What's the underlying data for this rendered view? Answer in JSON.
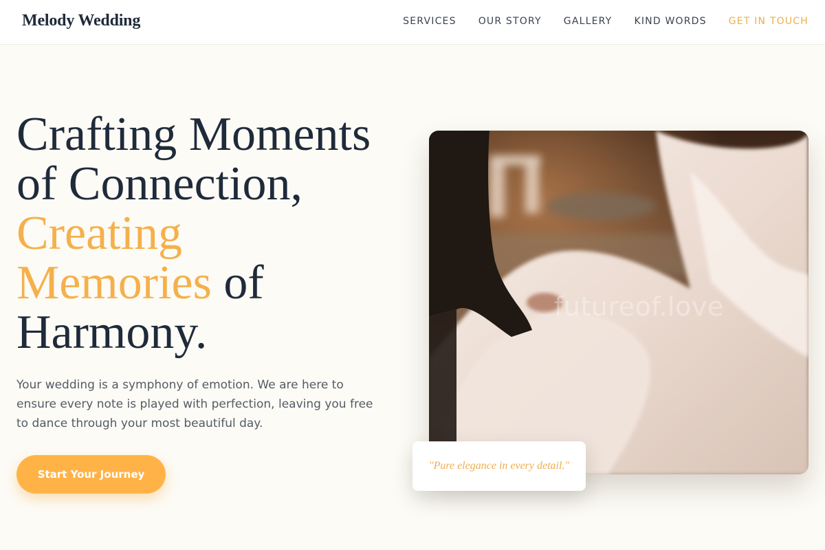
{
  "header": {
    "brand": "Melody Wedding",
    "nav": [
      {
        "label": "SERVICES"
      },
      {
        "label": "OUR STORY"
      },
      {
        "label": "GALLERY"
      },
      {
        "label": "KIND WORDS"
      },
      {
        "label": "GET IN TOUCH"
      }
    ]
  },
  "hero": {
    "headline_line1": "Crafting Moments",
    "headline_line2": "of Connection,",
    "headline_highlight1": "Creating",
    "headline_highlight2": "Memories",
    "headline_line4_rest": " of",
    "headline_line5": "Harmony.",
    "subtext": "Your wedding is a symphony of emotion. We are here to ensure every note is played with perfection, leaving you free to dance through your most beautiful day.",
    "cta_label": "Start Your Journey"
  },
  "photo": {
    "watermark": "futureof.love"
  },
  "quote": {
    "text": "\"Pure elegance in every detail.\""
  },
  "colors": {
    "background": "#fcfbf5",
    "accent": "#f5b04c",
    "button": "#ffb347",
    "text_dark": "#1f2a3a",
    "text_body": "#545b66"
  }
}
